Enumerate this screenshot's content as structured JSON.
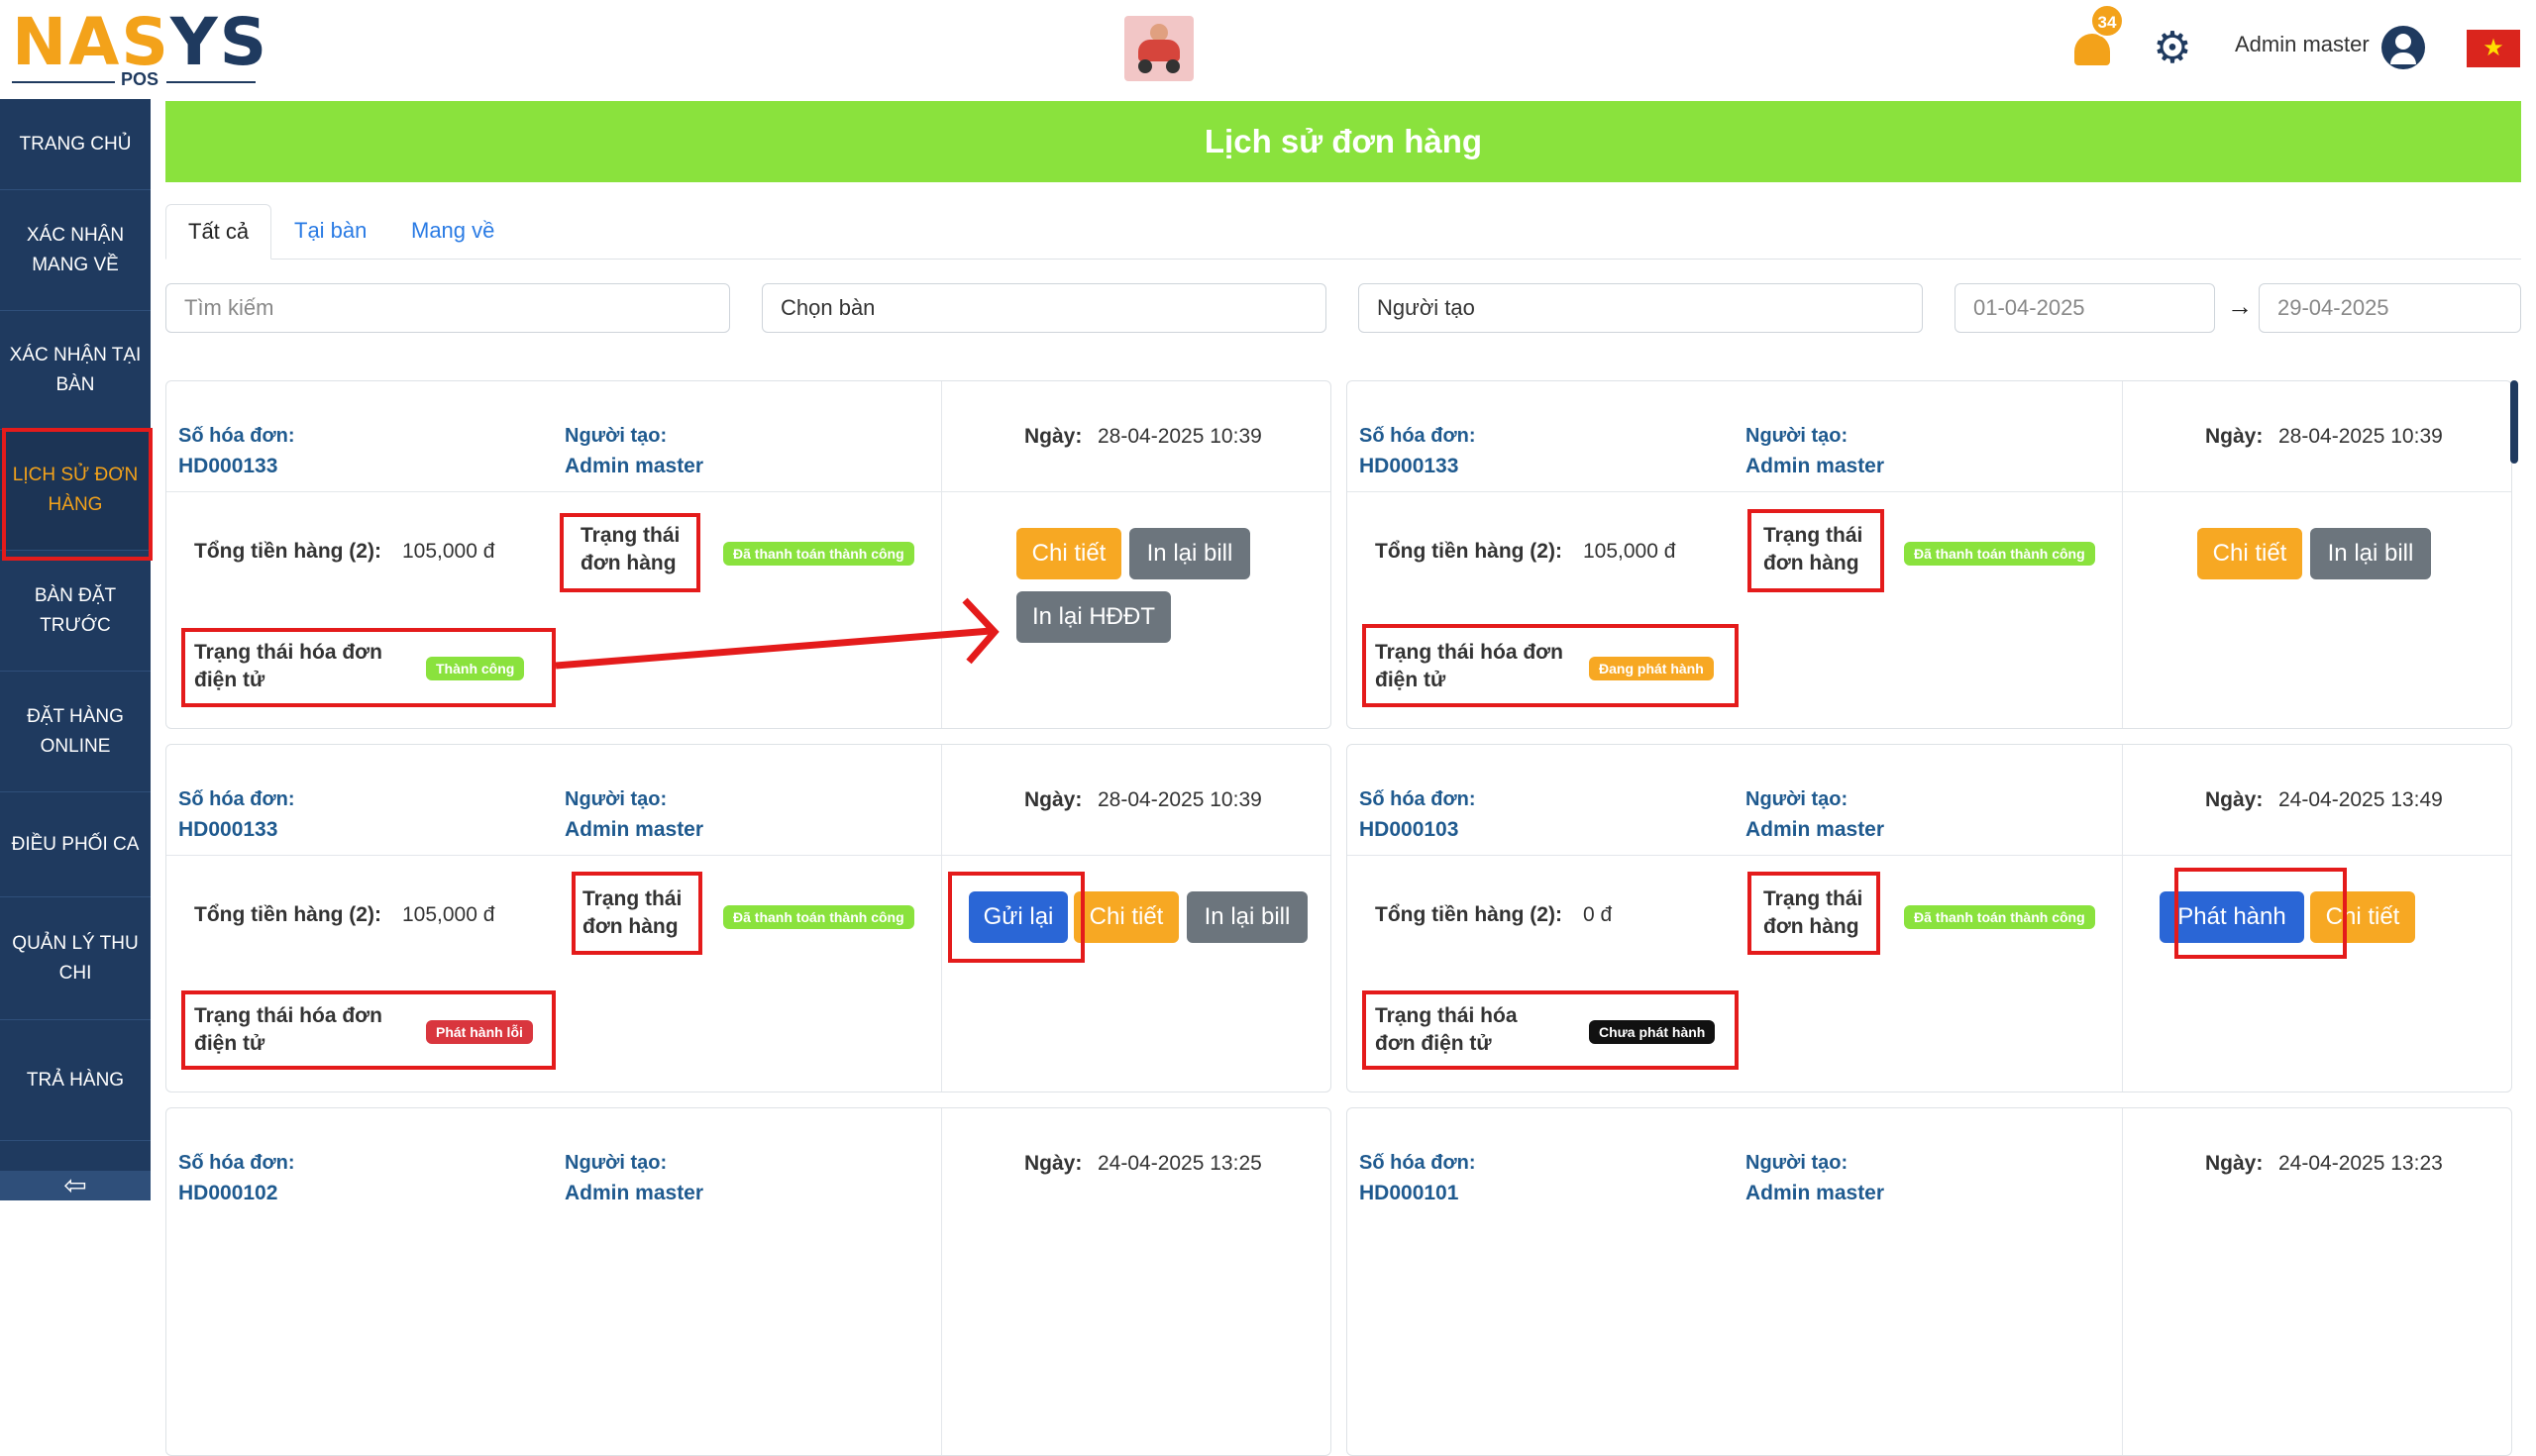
{
  "header": {
    "logo_word_a": "NAS",
    "logo_word_b": "YS",
    "logo_sub": "POS",
    "notifications_count": "34",
    "user_name": "Admin master",
    "flag_icon": "vietnam-flag-icon",
    "flag_star": "★"
  },
  "sidebar": {
    "items": [
      {
        "label": "TRANG CHỦ"
      },
      {
        "label": "XÁC NHẬN MANG VỀ"
      },
      {
        "label": "XÁC NHẬN TẠI BÀN"
      },
      {
        "label": "LỊCH SỬ ĐƠN HÀNG"
      },
      {
        "label": "BÀN ĐẶT TRƯỚC"
      },
      {
        "label": "ĐẶT HÀNG ONLINE"
      },
      {
        "label": "ĐIỀU PHỐI CA"
      },
      {
        "label": "QUẢN LÝ THU CHI"
      },
      {
        "label": "TRẢ HÀNG"
      }
    ],
    "back_icon": "⇦"
  },
  "page": {
    "title": "Lịch sử đơn hàng",
    "tabs": [
      {
        "label": "Tất cả"
      },
      {
        "label": "Tại bàn"
      },
      {
        "label": "Mang về"
      }
    ]
  },
  "filters": {
    "search_placeholder": "Tìm kiếm",
    "table_value": "Chọn bàn",
    "creator_value": "Người tạo",
    "date_from": "01-04-2025",
    "date_to": "29-04-2025",
    "arrow": "→"
  },
  "labels": {
    "invoice_no": "Số hóa đơn:",
    "creator": "Người tạo:",
    "date": "Ngày:",
    "total": "Tổng tiền hàng (2):",
    "order_status_1": "Trạng thái",
    "order_status_2": "đơn hàng",
    "einvoice_status": "Trạng thái hóa đơn điện tử",
    "einvoice_status_a": "Trạng thái hóa",
    "einvoice_status_b": "đơn điện tử"
  },
  "orders": [
    {
      "invoice": "HD000133",
      "creator": "Admin master",
      "date": "28-04-2025 10:39",
      "total": "105,000 đ",
      "order_status": "Đã thanh toán thành công",
      "einvoice_status": "Thành công",
      "einvoice_color": "#8ae23d",
      "buttons": [
        "Chi tiết",
        "In lại bill",
        "In lại HĐĐT"
      ]
    },
    {
      "invoice": "HD000133",
      "creator": "Admin master",
      "date": "28-04-2025 10:39",
      "total": "105,000 đ",
      "order_status": "Đã thanh toán thành công",
      "einvoice_status": "Đang phát hành",
      "einvoice_color": "#f7a823",
      "buttons": [
        "Chi tiết",
        "In lại bill"
      ]
    },
    {
      "invoice": "HD000133",
      "creator": "Admin master",
      "date": "28-04-2025 10:39",
      "total": "105,000 đ",
      "order_status": "Đã thanh toán thành công",
      "einvoice_status": "Phát hành lỗi",
      "einvoice_color": "#d9363e",
      "buttons": [
        "Gửi lại",
        "Chi tiết",
        "In lại bill"
      ]
    },
    {
      "invoice": "HD000103",
      "creator": "Admin master",
      "date": "24-04-2025 13:49",
      "total": "0 đ",
      "order_status": "Đã thanh toán thành công",
      "einvoice_status": "Chưa phát hành",
      "einvoice_color": "#111111",
      "buttons": [
        "Phát hành",
        "Chi tiết"
      ]
    },
    {
      "invoice": "HD000102",
      "creator": "Admin master",
      "date": "24-04-2025 13:25"
    },
    {
      "invoice": "HD000101",
      "creator": "Admin master",
      "date": "24-04-2025 13:23"
    }
  ],
  "colors": {
    "accent_green": "#8ae23d",
    "navy": "#1f3a5f",
    "orange": "#f7a823",
    "annotation_red": "#e41b1b"
  }
}
